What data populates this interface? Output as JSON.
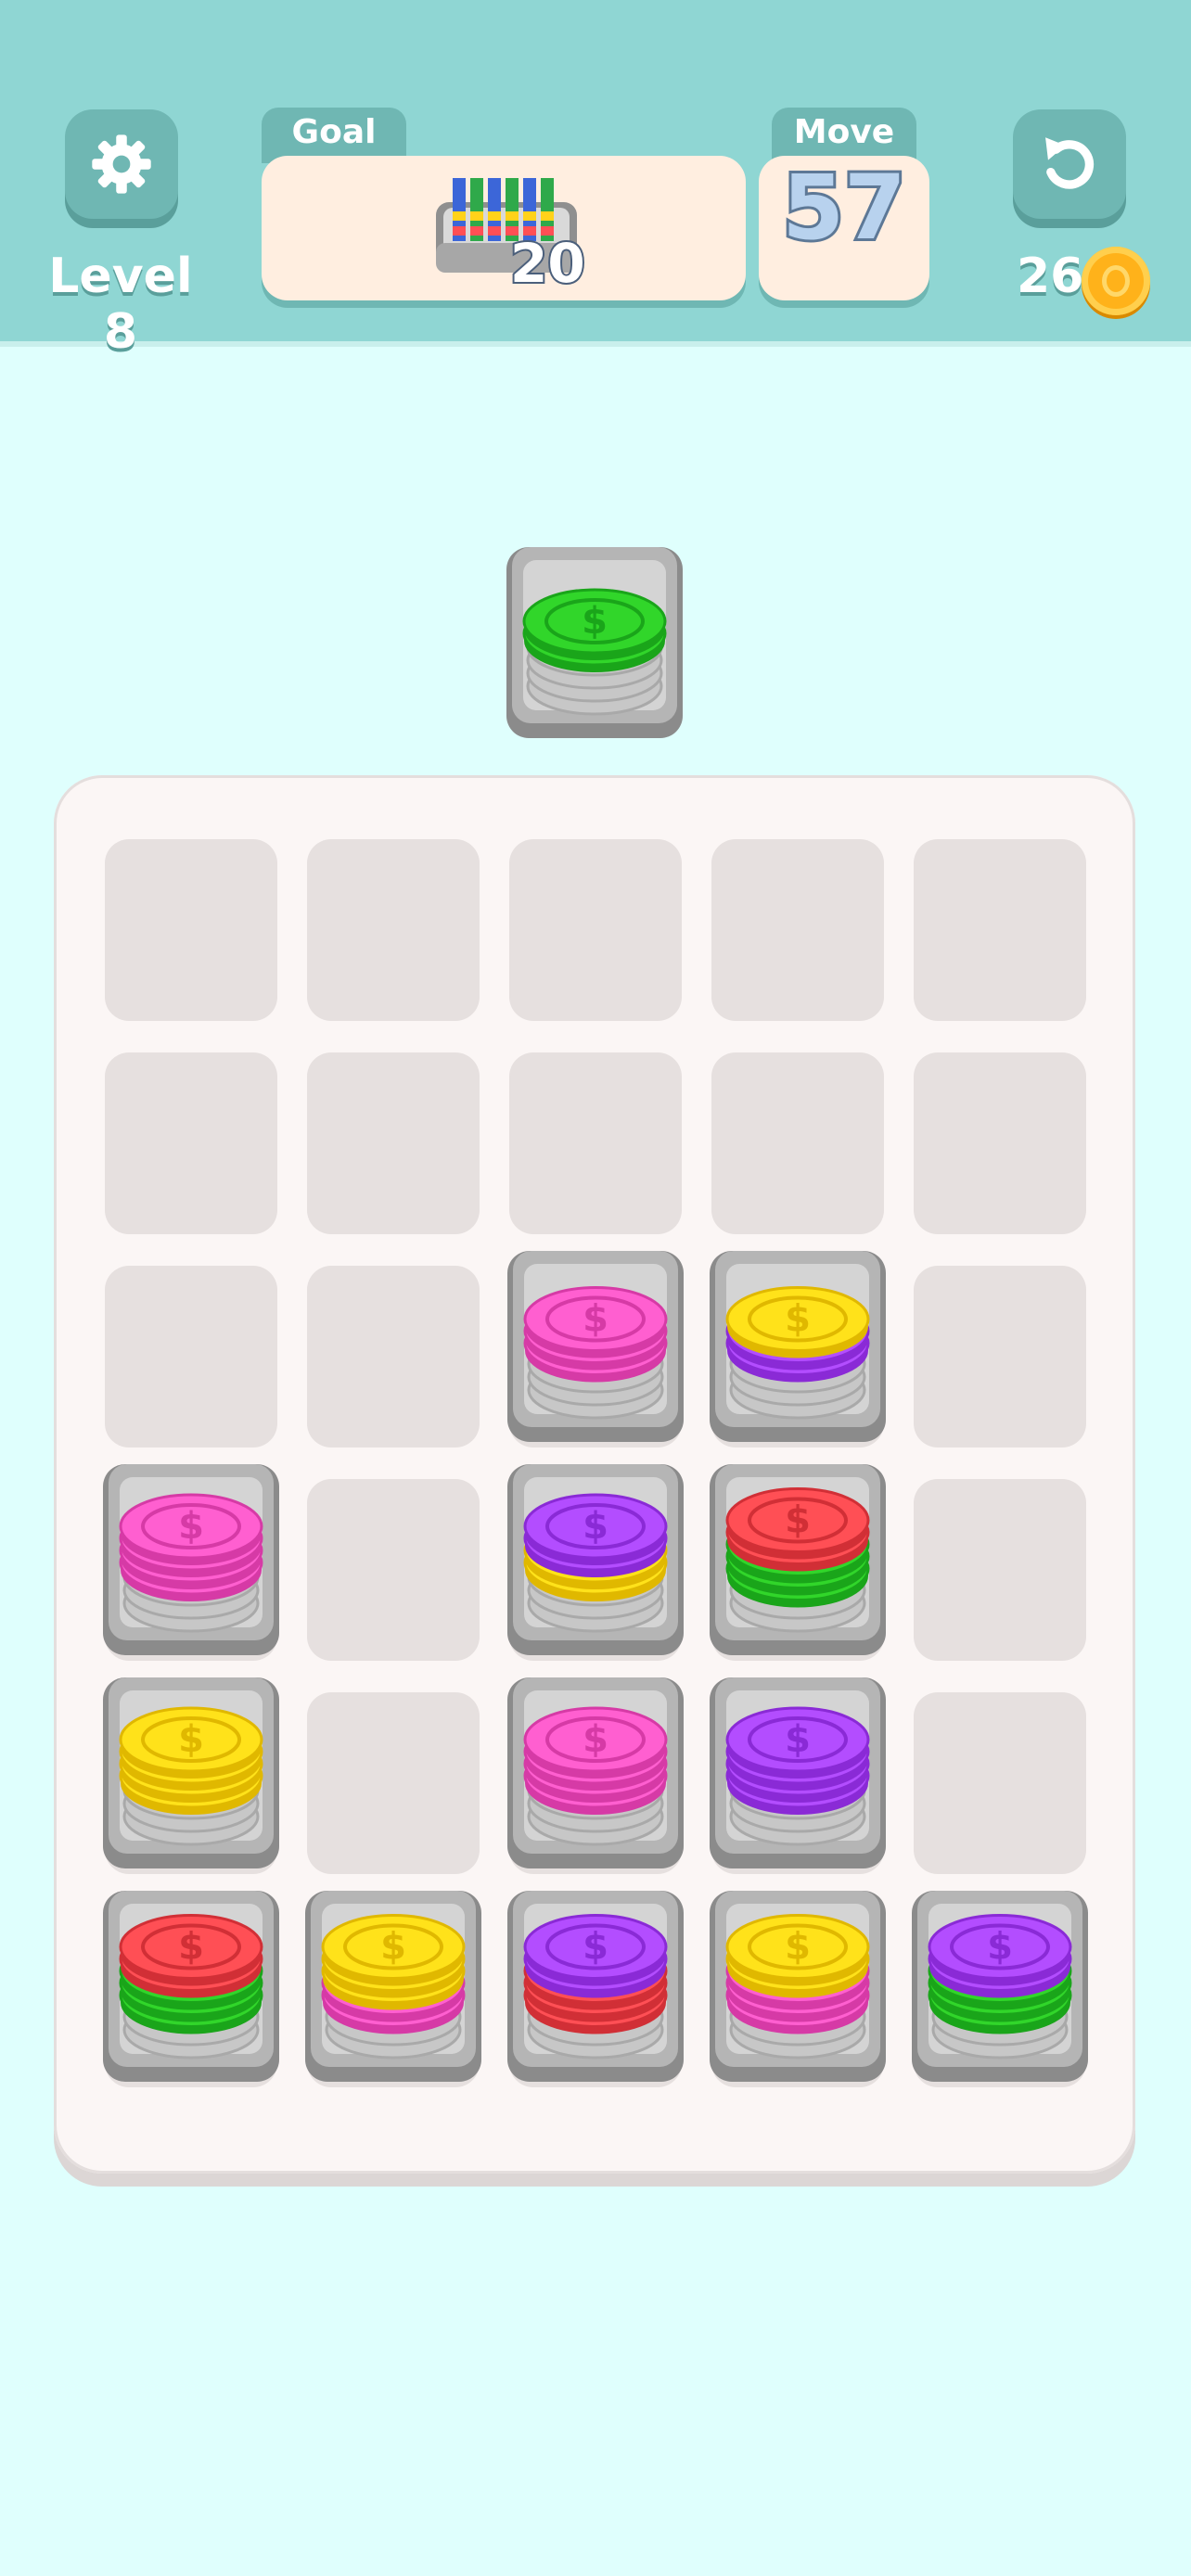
{
  "header": {
    "level_label": "Level 8",
    "goal_label": "Goal",
    "goal_count": "20",
    "move_label": "Move",
    "move_count": "57",
    "coins": "26"
  },
  "icons": {
    "settings": "gear-icon",
    "restart": "restart-icon",
    "coin": "coin-icon",
    "goal": "goal-crate-icon"
  },
  "colors": {
    "header_bg": "#8fd6d3",
    "page_bg": "#dffffd",
    "green": "#31d62a",
    "pink": "#ff5fd0",
    "yellow": "#ffe21a",
    "purple": "#b34dff",
    "red": "#ff4f55"
  },
  "board": {
    "rows": 6,
    "cols": 5,
    "next_stack": {
      "layers": [
        "green",
        "green"
      ]
    },
    "stacks": [
      {
        "row": 2,
        "col": 2,
        "layers": [
          "pink",
          "pink",
          "pink"
        ]
      },
      {
        "row": 2,
        "col": 3,
        "layers": [
          "purple",
          "purple",
          "yellow"
        ]
      },
      {
        "row": 3,
        "col": 0,
        "layers": [
          "pink",
          "pink",
          "pink",
          "pink"
        ]
      },
      {
        "row": 3,
        "col": 2,
        "layers": [
          "yellow",
          "yellow",
          "purple",
          "purple"
        ]
      },
      {
        "row": 3,
        "col": 3,
        "layers": [
          "green",
          "green",
          "green",
          "red",
          "red"
        ]
      },
      {
        "row": 4,
        "col": 0,
        "layers": [
          "yellow",
          "yellow",
          "yellow",
          "yellow"
        ]
      },
      {
        "row": 4,
        "col": 2,
        "layers": [
          "pink",
          "pink",
          "pink",
          "pink"
        ]
      },
      {
        "row": 4,
        "col": 3,
        "layers": [
          "purple",
          "purple",
          "purple",
          "purple"
        ]
      },
      {
        "row": 5,
        "col": 0,
        "layers": [
          "green",
          "green",
          "green",
          "red",
          "red"
        ]
      },
      {
        "row": 5,
        "col": 1,
        "layers": [
          "pink",
          "pink",
          "yellow",
          "yellow",
          "yellow"
        ]
      },
      {
        "row": 5,
        "col": 2,
        "layers": [
          "red",
          "red",
          "red",
          "purple",
          "purple"
        ]
      },
      {
        "row": 5,
        "col": 3,
        "layers": [
          "pink",
          "pink",
          "pink",
          "yellow",
          "yellow"
        ]
      },
      {
        "row": 5,
        "col": 4,
        "layers": [
          "green",
          "green",
          "green",
          "purple",
          "purple"
        ]
      }
    ]
  }
}
